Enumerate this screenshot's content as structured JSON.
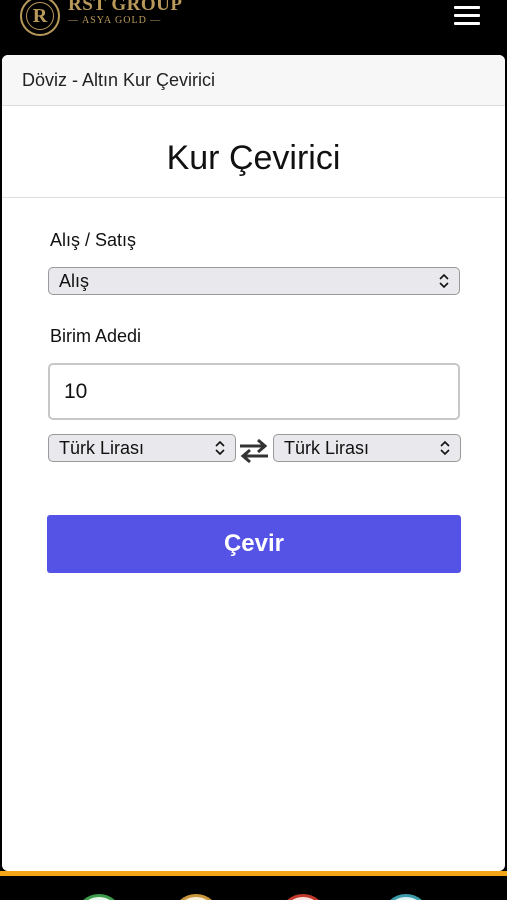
{
  "brand": {
    "title": "RST GROUP",
    "subtitle": "— ASYA GOLD —",
    "monogram": "R",
    "gold_color": "#b99a5b"
  },
  "header": {
    "breadcrumb": "Döviz - Altın Kur Çevirici",
    "page_title": "Kur Çevirici"
  },
  "form": {
    "type_label": "Alış / Satış",
    "type_value": "Alış",
    "amount_label": "Birim Adedi",
    "amount_value": "10",
    "from_currency": "Türk Lirası",
    "to_currency": "Türk Lirası",
    "convert_label": "Çevir"
  },
  "colors": {
    "accent": "#5552e6",
    "bottom_border": "#f2a516"
  },
  "icons": {
    "menu": "hamburger-menu-icon",
    "swap": "swap-arrows-icon",
    "chevron": "updown-chevron-icon"
  }
}
